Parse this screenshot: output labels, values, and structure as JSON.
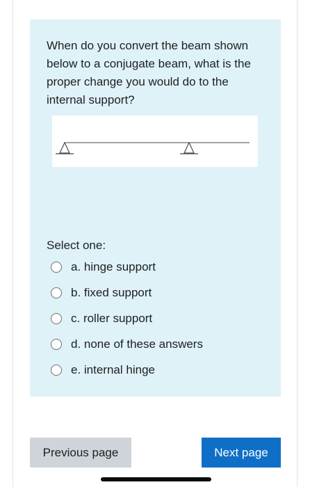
{
  "question": {
    "text": "When do you convert the beam shown below to a conjugate beam, what is the proper change you would do to the internal support?",
    "figure": "beam-with-two-pin-supports"
  },
  "answers": {
    "prompt": "Select one:",
    "options": [
      {
        "label": "a. hinge support",
        "selected": false
      },
      {
        "label": "b. fixed support",
        "selected": false
      },
      {
        "label": "c.  roller support",
        "selected": false
      },
      {
        "label": "d. none of these answers",
        "selected": false
      },
      {
        "label": "e.  internal hinge",
        "selected": false
      }
    ]
  },
  "navigation": {
    "previous_label": "Previous page",
    "next_label": "Next page"
  },
  "colors": {
    "card_background": "#def2f8",
    "next_button": "#0f6fc6",
    "previous_button": "#ced4da"
  }
}
